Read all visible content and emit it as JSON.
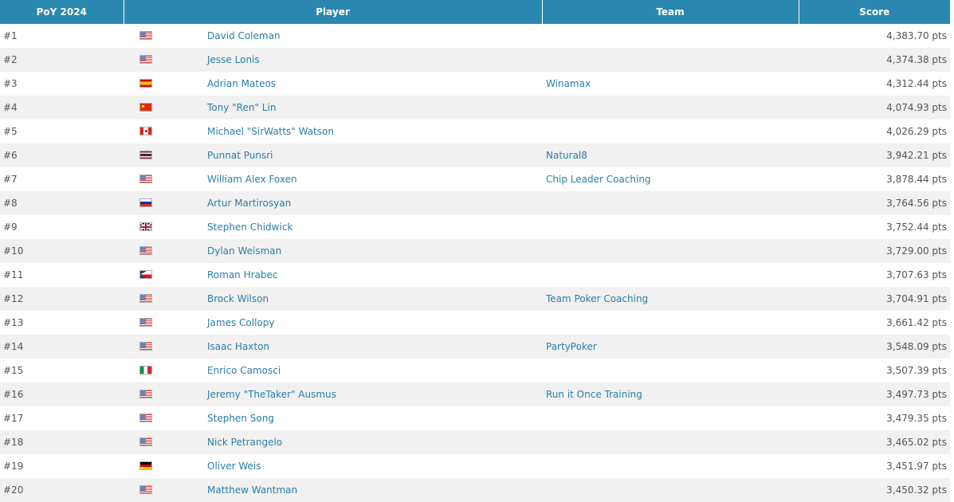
{
  "header": {
    "poy": "PoY 2024",
    "player": "Player",
    "team": "Team",
    "score": "Score"
  },
  "rows": [
    {
      "rank": "#1",
      "flag": "us-flag-icon",
      "name": "David Coleman",
      "team": "",
      "score": "4,383.70 pts"
    },
    {
      "rank": "#2",
      "flag": "us-flag-icon",
      "name": "Jesse Lonis",
      "team": "",
      "score": "4,374.38 pts"
    },
    {
      "rank": "#3",
      "flag": "es-flag-icon",
      "name": "Adrian Mateos",
      "team": "Winamax",
      "score": "4,312.44 pts"
    },
    {
      "rank": "#4",
      "flag": "cn-flag-icon",
      "name": "Tony \"Ren\" Lin",
      "team": "",
      "score": "4,074.93 pts"
    },
    {
      "rank": "#5",
      "flag": "ca-flag-icon",
      "name": "Michael \"SirWatts\" Watson",
      "team": "",
      "score": "4,026.29 pts"
    },
    {
      "rank": "#6",
      "flag": "th-flag-icon",
      "name": "Punnat Punsri",
      "team": "Natural8",
      "score": "3,942.21 pts"
    },
    {
      "rank": "#7",
      "flag": "us-flag-icon",
      "name": "William Alex Foxen",
      "team": "Chip Leader Coaching",
      "score": "3,878.44 pts"
    },
    {
      "rank": "#8",
      "flag": "ru-flag-icon",
      "name": "Artur Martirosyan",
      "team": "",
      "score": "3,764.56 pts"
    },
    {
      "rank": "#9",
      "flag": "gb-flag-icon",
      "name": "Stephen Chidwick",
      "team": "",
      "score": "3,752.44 pts"
    },
    {
      "rank": "#10",
      "flag": "us-flag-icon",
      "name": "Dylan Weisman",
      "team": "",
      "score": "3,729.00 pts"
    },
    {
      "rank": "#11",
      "flag": "cz-flag-icon",
      "name": "Roman Hrabec",
      "team": "",
      "score": "3,707.63 pts"
    },
    {
      "rank": "#12",
      "flag": "us-flag-icon",
      "name": "Brock Wilson",
      "team": "Team Poker Coaching",
      "score": "3,704.91 pts"
    },
    {
      "rank": "#13",
      "flag": "us-flag-icon",
      "name": "James Collopy",
      "team": "",
      "score": "3,661.42 pts"
    },
    {
      "rank": "#14",
      "flag": "us-flag-icon",
      "name": "Isaac Haxton",
      "team": "PartyPoker",
      "score": "3,548.09 pts"
    },
    {
      "rank": "#15",
      "flag": "it-flag-icon",
      "name": "Enrico Camosci",
      "team": "",
      "score": "3,507.39 pts"
    },
    {
      "rank": "#16",
      "flag": "us-flag-icon",
      "name": "Jeremy \"TheTaker\" Ausmus",
      "team": "Run it Once Training",
      "score": "3,497.73 pts"
    },
    {
      "rank": "#17",
      "flag": "us-flag-icon",
      "name": "Stephen Song",
      "team": "",
      "score": "3,479.35 pts"
    },
    {
      "rank": "#18",
      "flag": "us-flag-icon",
      "name": "Nick Petrangelo",
      "team": "",
      "score": "3,465.02 pts"
    },
    {
      "rank": "#19",
      "flag": "de-flag-icon",
      "name": "Oliver Weis",
      "team": "",
      "score": "3,451.97 pts"
    },
    {
      "rank": "#20",
      "flag": "us-flag-icon",
      "name": "Matthew Wantman",
      "team": "",
      "score": "3,450.32 pts"
    }
  ]
}
